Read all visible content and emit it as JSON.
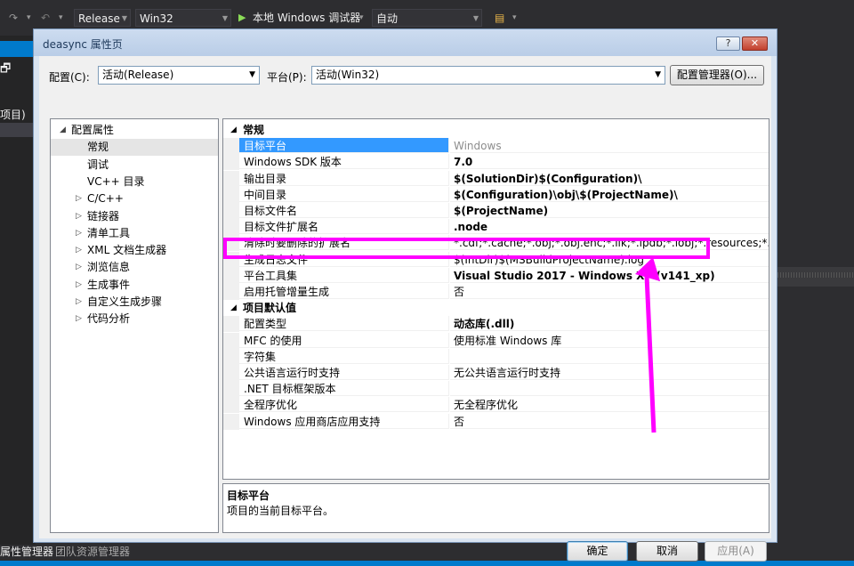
{
  "vs": {
    "toolbar": {
      "config_combo": "Release",
      "platform_combo": "Win32",
      "run_label": "本地 Windows 调试器",
      "run_mode": "自动"
    },
    "left_fragments": [
      "项目)"
    ],
    "bottom_fragments": [
      "属性管理器",
      "团队资源管理器"
    ]
  },
  "dialog": {
    "title": "deasync 属性页",
    "help_label": "?",
    "close_label": "✕",
    "config_label": "配置(C):",
    "config_value": "活动(Release)",
    "platform_label": "平台(P):",
    "platform_value": "活动(Win32)",
    "config_manager_label": "配置管理器(O)...",
    "tree": [
      {
        "label": "配置属性",
        "expander": "◢",
        "level": 0
      },
      {
        "label": "常规",
        "expander": "",
        "level": 1,
        "selected": true
      },
      {
        "label": "调试",
        "expander": "",
        "level": 1
      },
      {
        "label": "VC++ 目录",
        "expander": "",
        "level": 1
      },
      {
        "label": "C/C++",
        "expander": "▷",
        "level": 1
      },
      {
        "label": "链接器",
        "expander": "▷",
        "level": 1
      },
      {
        "label": "清单工具",
        "expander": "▷",
        "level": 1
      },
      {
        "label": "XML 文档生成器",
        "expander": "▷",
        "level": 1
      },
      {
        "label": "浏览信息",
        "expander": "▷",
        "level": 1
      },
      {
        "label": "生成事件",
        "expander": "▷",
        "level": 1
      },
      {
        "label": "自定义生成步骤",
        "expander": "▷",
        "level": 1
      },
      {
        "label": "代码分析",
        "expander": "▷",
        "level": 1
      }
    ],
    "grid": {
      "cat1": {
        "label": "常规",
        "expander": "◢"
      },
      "rows1": [
        {
          "name": "目标平台",
          "value": "Windows",
          "style": "gray",
          "selected": true
        },
        {
          "name": "Windows SDK 版本",
          "value": "7.0",
          "style": "bold"
        },
        {
          "name": "输出目录",
          "value": "$(SolutionDir)$(Configuration)\\",
          "style": "bold"
        },
        {
          "name": "中间目录",
          "value": "$(Configuration)\\obj\\$(ProjectName)\\",
          "style": "bold"
        },
        {
          "name": "目标文件名",
          "value": "$(ProjectName)",
          "style": "bold"
        },
        {
          "name": "目标文件扩展名",
          "value": ".node",
          "style": "bold"
        },
        {
          "name": "清除时要删除的扩展名",
          "value": "*.cdf;*.cache;*.obj;*.obj.enc;*.ilk;*.ipdb;*.iobj;*.resources;*.tlb;*.tli;*",
          "style": ""
        },
        {
          "name": "生成日志文件",
          "value": "$(IntDir)$(MSBuildProjectName).log",
          "style": ""
        },
        {
          "name": "平台工具集",
          "value": "Visual Studio 2017 - Windows XP (v141_xp)",
          "style": "bold"
        },
        {
          "name": "启用托管增量生成",
          "value": "否",
          "style": ""
        }
      ],
      "cat2": {
        "label": "项目默认值",
        "expander": "◢"
      },
      "rows2": [
        {
          "name": "配置类型",
          "value": "动态库(.dll)",
          "style": "bold"
        },
        {
          "name": "MFC 的使用",
          "value": "使用标准 Windows 库",
          "style": ""
        },
        {
          "name": "字符集",
          "value": "",
          "style": ""
        },
        {
          "name": "公共语言运行时支持",
          "value": "无公共语言运行时支持",
          "style": ""
        },
        {
          "name": ".NET 目标框架版本",
          "value": "",
          "style": ""
        },
        {
          "name": "全程序优化",
          "value": "无全程序优化",
          "style": ""
        },
        {
          "name": "Windows 应用商店应用支持",
          "value": "否",
          "style": ""
        }
      ]
    },
    "description": {
      "title": "目标平台",
      "text": "项目的当前目标平台。"
    },
    "buttons": {
      "ok": "确定",
      "cancel": "取消",
      "apply": "应用(A)"
    }
  },
  "annotation_color": "#ff00ff"
}
